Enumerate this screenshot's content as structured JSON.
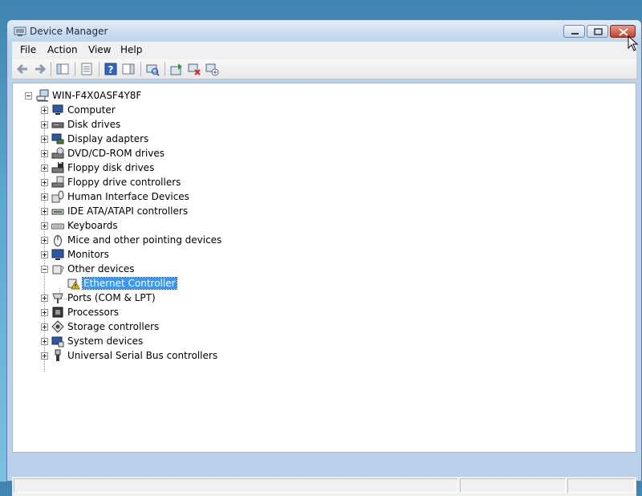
{
  "window": {
    "title": "Device Manager"
  },
  "menu": [
    "File",
    "Action",
    "View",
    "Help"
  ],
  "toolbar": {
    "buttons": [
      "back-icon",
      "forward-icon",
      "show-hide-tree-icon",
      "properties-icon",
      "help-icon",
      "action-pane-icon",
      "scan-hardware-icon",
      "update-driver-icon",
      "uninstall-icon",
      "disable-icon"
    ]
  },
  "tree": {
    "root": "WIN-F4X0ASF4Y8F",
    "categories": [
      {
        "label": "Computer",
        "icon": "computer-icon"
      },
      {
        "label": "Disk drives",
        "icon": "disk-drive-icon"
      },
      {
        "label": "Display adapters",
        "icon": "display-adapter-icon"
      },
      {
        "label": "DVD/CD-ROM drives",
        "icon": "dvd-drive-icon"
      },
      {
        "label": "Floppy disk drives",
        "icon": "floppy-drive-icon"
      },
      {
        "label": "Floppy drive controllers",
        "icon": "floppy-controller-icon"
      },
      {
        "label": "Human Interface Devices",
        "icon": "hid-icon"
      },
      {
        "label": "IDE ATA/ATAPI controllers",
        "icon": "ide-controller-icon"
      },
      {
        "label": "Keyboards",
        "icon": "keyboard-icon"
      },
      {
        "label": "Mice and other pointing devices",
        "icon": "mouse-icon"
      },
      {
        "label": "Monitors",
        "icon": "monitor-icon"
      },
      {
        "label": "Other devices",
        "icon": "other-devices-icon",
        "expanded": true
      },
      {
        "label": "Ports (COM & LPT)",
        "icon": "port-icon"
      },
      {
        "label": "Processors",
        "icon": "processor-icon"
      },
      {
        "label": "Storage controllers",
        "icon": "storage-controller-icon"
      },
      {
        "label": "System devices",
        "icon": "system-device-icon"
      },
      {
        "label": "Universal Serial Bus controllers",
        "icon": "usb-icon"
      }
    ],
    "other_devices_children": [
      {
        "label": "Ethernet Controller",
        "icon": "warning-device-icon",
        "selected": true
      }
    ]
  },
  "colors": {
    "selection": "#3399ff",
    "title_bar": "#cddff1",
    "warning": "#f2c200"
  }
}
